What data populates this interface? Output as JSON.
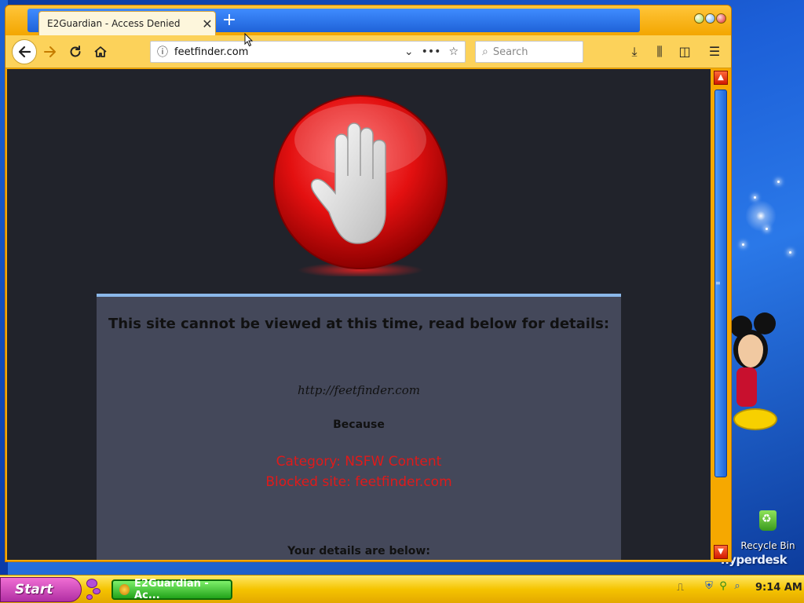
{
  "window": {
    "tab_title": "E2Guardian - Access Denied",
    "tab_close": "✕",
    "new_tab": "+"
  },
  "navbar": {
    "url": "feetfinder.com",
    "search_placeholder": "Search"
  },
  "page": {
    "heading": "This site cannot be viewed at this time, read below for details:",
    "blocked_url": "http://feetfinder.com",
    "because": "Because",
    "category": "Category: NSFW Content",
    "blocked_site": "Blocked site: feetfinder.com",
    "details_heading": "Your details are below:"
  },
  "desktop": {
    "recycle_bin": "Recycle Bin",
    "brand": "hyperdesk"
  },
  "taskbar": {
    "start": "Start",
    "task_label": "E2Guardian - Ac...",
    "clock": "9:14 AM"
  },
  "colors": {
    "window_frame": "#f6a800",
    "tab_strip": "#1f62d8",
    "page_bg": "#21232b",
    "panel_bg": "#44485a",
    "reason_red": "#e01a1a",
    "taskbar": "#f5c400",
    "start_button": "#b12fa3"
  },
  "icons": {
    "back": "arrow-left-icon",
    "forward": "arrow-right-icon",
    "reload": "reload-icon",
    "home": "home-icon",
    "info": "info-icon",
    "dropdown": "chevron-down-icon",
    "page_actions": "more-icon",
    "bookmark": "star-icon",
    "search": "search-icon",
    "downloads": "download-icon",
    "library": "library-icon",
    "sidebar": "sidebar-icon",
    "menu": "hamburger-menu-icon",
    "stop_hand": "stop-hand-icon"
  }
}
